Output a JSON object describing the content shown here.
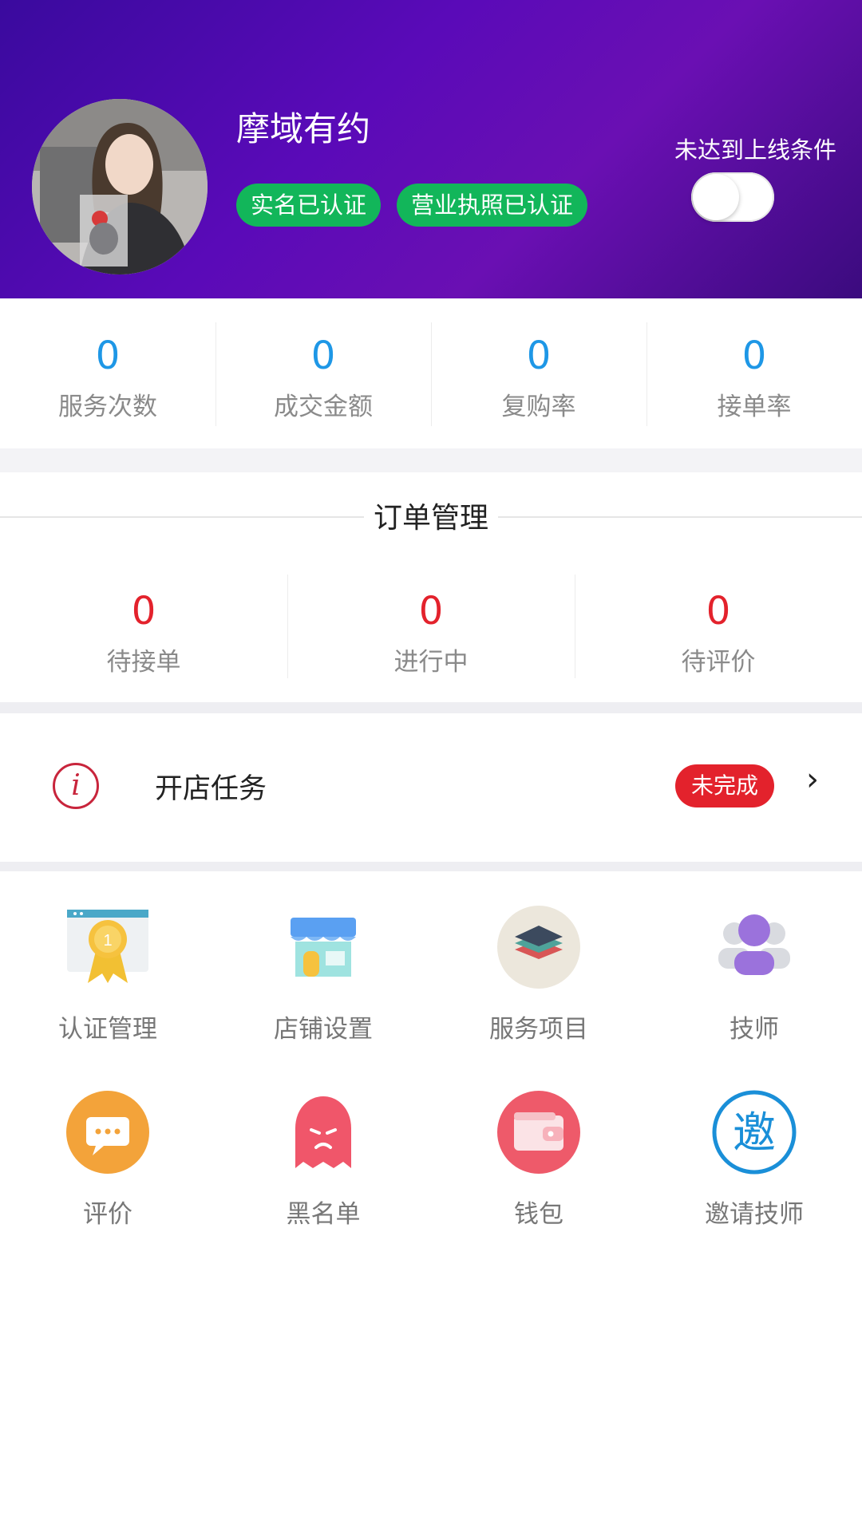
{
  "profile": {
    "name": "摩域有约",
    "badges": [
      "实名已认证",
      "营业执照已认证"
    ],
    "online_status_label": "未达到上线条件",
    "online_toggle": false
  },
  "stats": [
    {
      "value": "0",
      "label": "服务次数"
    },
    {
      "value": "0",
      "label": "成交金额"
    },
    {
      "value": "0",
      "label": "复购率"
    },
    {
      "value": "0",
      "label": "接单率"
    }
  ],
  "orders": {
    "title": "订单管理",
    "items": [
      {
        "value": "0",
        "label": "待接单"
      },
      {
        "value": "0",
        "label": "进行中"
      },
      {
        "value": "0",
        "label": "待评价"
      }
    ]
  },
  "task": {
    "icon": "info-icon",
    "title": "开店任务",
    "status": "未完成"
  },
  "menu": [
    {
      "label": "认证管理",
      "icon": "certificate-icon"
    },
    {
      "label": "店铺设置",
      "icon": "store-icon"
    },
    {
      "label": "服务项目",
      "icon": "layers-icon"
    },
    {
      "label": "技师",
      "icon": "technician-icon"
    },
    {
      "label": "评价",
      "icon": "comment-icon"
    },
    {
      "label": "黑名单",
      "icon": "ghost-icon"
    },
    {
      "label": "钱包",
      "icon": "wallet-icon"
    },
    {
      "label": "邀请技师",
      "icon": "invite-icon"
    }
  ],
  "colors": {
    "header_gradient": [
      "#3a0a9e",
      "#6a0fb3"
    ],
    "badge_green": "#12b65a",
    "stat_blue": "#1e97e6",
    "order_red": "#e3222c"
  }
}
